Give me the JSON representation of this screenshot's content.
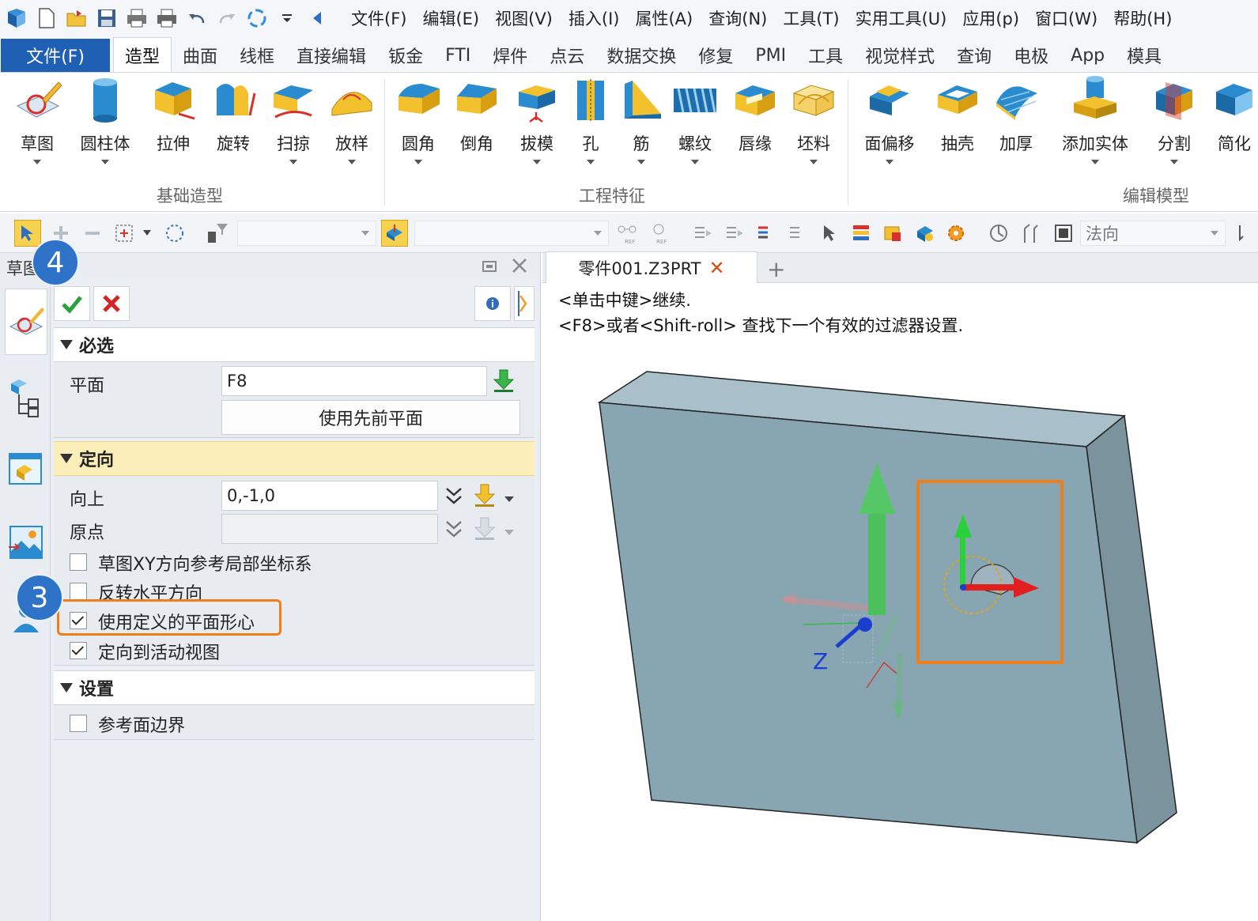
{
  "menu": {
    "items": [
      "文件(F)",
      "编辑(E)",
      "视图(V)",
      "插入(I)",
      "属性(A)",
      "查询(N)",
      "工具(T)",
      "实用工具(U)",
      "应用(p)",
      "窗口(W)",
      "帮助(H)"
    ]
  },
  "ribbon_tabs": {
    "file": "文件(F)",
    "tabs": [
      "造型",
      "曲面",
      "线框",
      "直接编辑",
      "钣金",
      "FTI",
      "焊件",
      "点云",
      "数据交换",
      "修复",
      "PMI",
      "工具",
      "视觉样式",
      "查询",
      "电极",
      "App",
      "模具"
    ],
    "active": "造型"
  },
  "ribbon": {
    "groups": [
      {
        "label": "基础造型",
        "buttons": [
          "草图",
          "圆柱体",
          "拉伸",
          "旋转",
          "扫掠",
          "放样"
        ]
      },
      {
        "label": "工程特征",
        "buttons": [
          "圆角",
          "倒角",
          "拔模",
          "孔",
          "筋",
          "螺纹",
          "唇缘",
          "坯料"
        ]
      },
      {
        "label": "编辑模型",
        "buttons": [
          "面偏移",
          "抽壳",
          "加厚",
          "添加实体",
          "分割",
          "简化"
        ]
      }
    ]
  },
  "toolbar": {
    "view_combo": "法向"
  },
  "panel": {
    "title": "草图",
    "sections": {
      "required": "必选",
      "orientation": "定向",
      "settings": "设置"
    },
    "plane_label": "平面",
    "plane_value": "F8",
    "use_previous_plane": "使用先前平面",
    "up_label": "向上",
    "up_value": "0,-1,0",
    "origin_label": "原点",
    "origin_value": "",
    "checkboxes": [
      {
        "label": "草图XY方向参考局部坐标系",
        "checked": false
      },
      {
        "label": "反转水平方向",
        "checked": false
      },
      {
        "label": "使用定义的平面形心",
        "checked": true
      },
      {
        "label": "定向到活动视图",
        "checked": true
      }
    ],
    "ref_face_boundary": {
      "label": "参考面边界",
      "checked": false
    }
  },
  "badges": {
    "step4": "4",
    "step3": "3"
  },
  "document": {
    "tab_title": "零件001.Z3PRT",
    "prompt_lines": [
      "<单击中键>继续.",
      "<F8>或者<Shift-roll> 查找下一个有效的过滤器设置."
    ],
    "axis_label": "Z"
  },
  "colors": {
    "file_tab": "#1f5fb4",
    "highlight": "#ee7f1b",
    "badge": "#2f73c9",
    "section_yellow": "#fbeeb8",
    "solid_face": "#87a6b2",
    "accept": "#2aa13b",
    "cancel": "#d42424"
  }
}
